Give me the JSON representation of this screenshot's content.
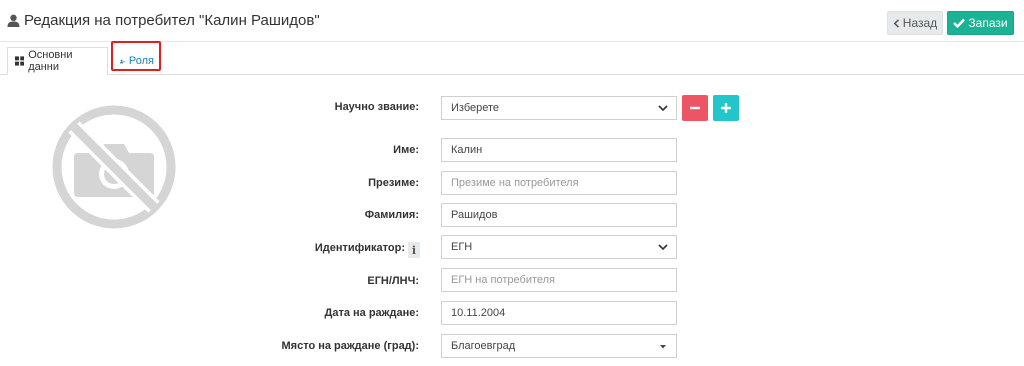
{
  "header": {
    "title": "Редакция на потребител \"Калин Рашидов\"",
    "back_label": "Назад",
    "save_label": "Запази"
  },
  "tabs": [
    {
      "label": "Основни данни",
      "active": true
    },
    {
      "label": "Роля",
      "active": false
    }
  ],
  "form": {
    "academic_title": {
      "label": "Научно звание:",
      "value": "Изберете"
    },
    "first_name": {
      "label": "Име:",
      "value": "Калин"
    },
    "middle_name": {
      "label": "Презиме:",
      "value": "",
      "placeholder": "Презиме на потребителя"
    },
    "last_name": {
      "label": "Фамилия:",
      "value": "Рашидов"
    },
    "identifier": {
      "label": "Идентификатор:",
      "value": "ЕГН"
    },
    "egn": {
      "label": "ЕГН/ЛНЧ:",
      "value": "",
      "placeholder": "ЕГН на потребителя"
    },
    "birth_date": {
      "label": "Дата на раждане:",
      "value": "10.11.2004"
    },
    "birth_place": {
      "label": "Място на раждане (град):",
      "value": "Благоевград"
    }
  },
  "colors": {
    "save": "#1ab394",
    "back": "#e7eaec",
    "remove": "#ed5565",
    "add": "#23c6c8",
    "link": "#1c84c6",
    "highlight": "#e02020"
  },
  "icons": {
    "title": "user-icon",
    "back": "chevron-left-icon",
    "save": "check-icon",
    "tab_main": "grid-icon",
    "tab_role": "user-plus-icon",
    "photo": "no-camera-icon",
    "info": "info-icon"
  }
}
